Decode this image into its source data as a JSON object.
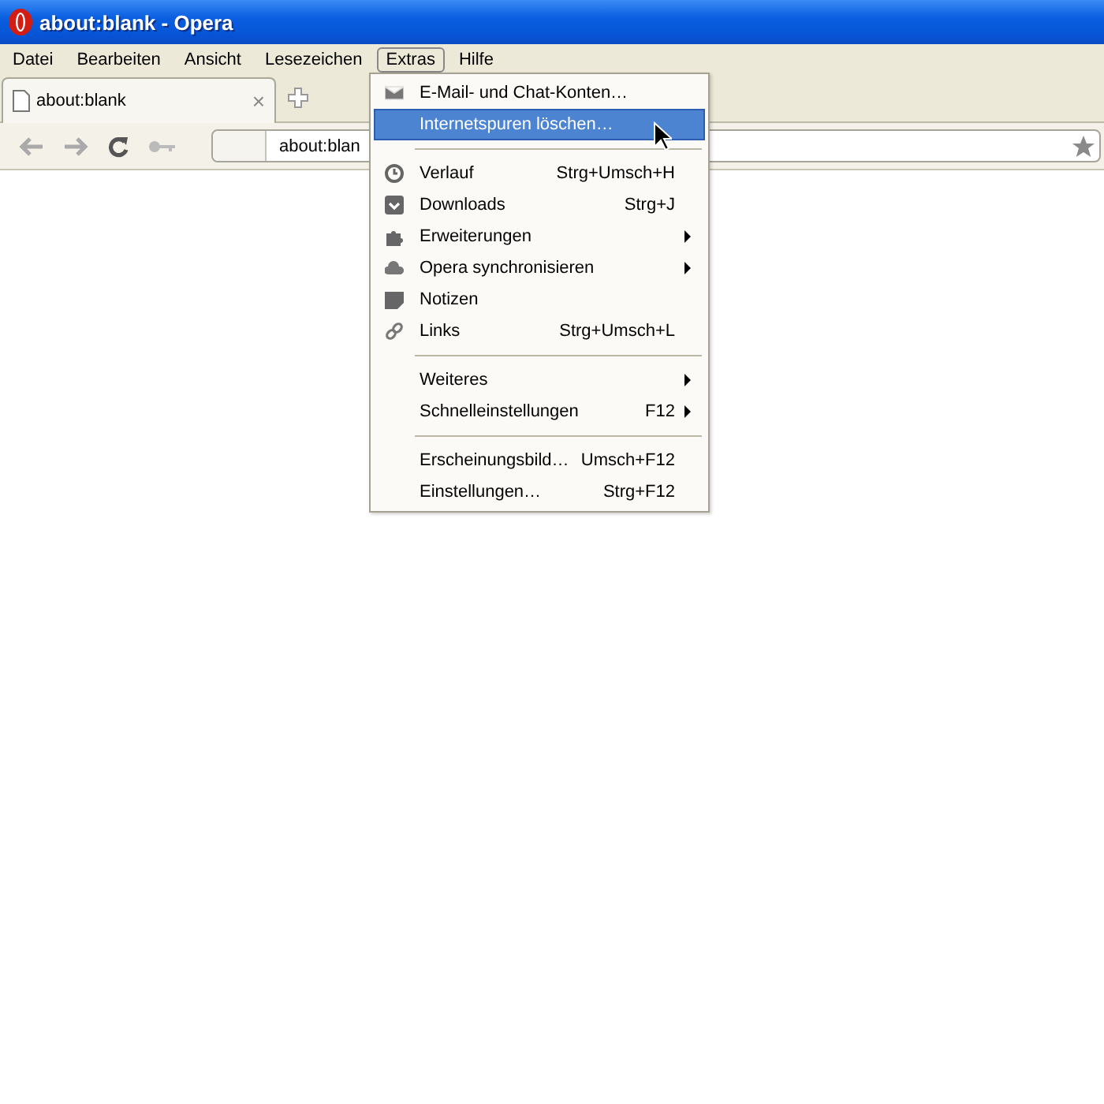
{
  "window": {
    "title": "about:blank - Opera"
  },
  "menubar": [
    {
      "label": "Datei",
      "selected": false
    },
    {
      "label": "Bearbeiten",
      "selected": false
    },
    {
      "label": "Ansicht",
      "selected": false
    },
    {
      "label": "Lesezeichen",
      "selected": false
    },
    {
      "label": "Extras",
      "selected": true
    },
    {
      "label": "Hilfe",
      "selected": false
    }
  ],
  "tabs": [
    {
      "label": "about:blank",
      "selected": true,
      "close": "×"
    }
  ],
  "address_bar": {
    "value": "about:blan"
  },
  "menu": {
    "items": [
      {
        "kind": "item",
        "label": "E-Mail- und Chat-Konten…",
        "selected": false,
        "submenu": false
      },
      {
        "kind": "item",
        "label": "Internetspuren löschen…",
        "selected": true,
        "submenu": false
      },
      {
        "kind": "separator"
      },
      {
        "kind": "item",
        "label": "Verlauf",
        "shortcut": "Strg+Umsch+H",
        "selected": false,
        "submenu": false
      },
      {
        "kind": "item",
        "label": "Downloads",
        "shortcut": "Strg+J",
        "selected": false,
        "submenu": false
      },
      {
        "kind": "item",
        "label": "Erweiterungen",
        "selected": false,
        "submenu": true
      },
      {
        "kind": "item",
        "label": "Opera synchronisieren",
        "selected": false,
        "submenu": true
      },
      {
        "kind": "item",
        "label": "Notizen",
        "selected": false,
        "submenu": false
      },
      {
        "kind": "item",
        "label": "Links",
        "shortcut": "Strg+Umsch+L",
        "selected": false,
        "submenu": false
      },
      {
        "kind": "separator"
      },
      {
        "kind": "item",
        "label": "Weiteres",
        "selected": false,
        "submenu": true
      },
      {
        "kind": "item",
        "label": "Schnelleinstellungen",
        "shortcut": "F12",
        "selected": false,
        "submenu": true
      },
      {
        "kind": "separator"
      },
      {
        "kind": "item",
        "label": "Erscheinungsbild…",
        "shortcut": "Umsch+F12",
        "selected": false,
        "submenu": false
      },
      {
        "kind": "item",
        "label": "Einstellungen…",
        "shortcut": "Strg+F12",
        "selected": false,
        "submenu": false
      }
    ]
  }
}
